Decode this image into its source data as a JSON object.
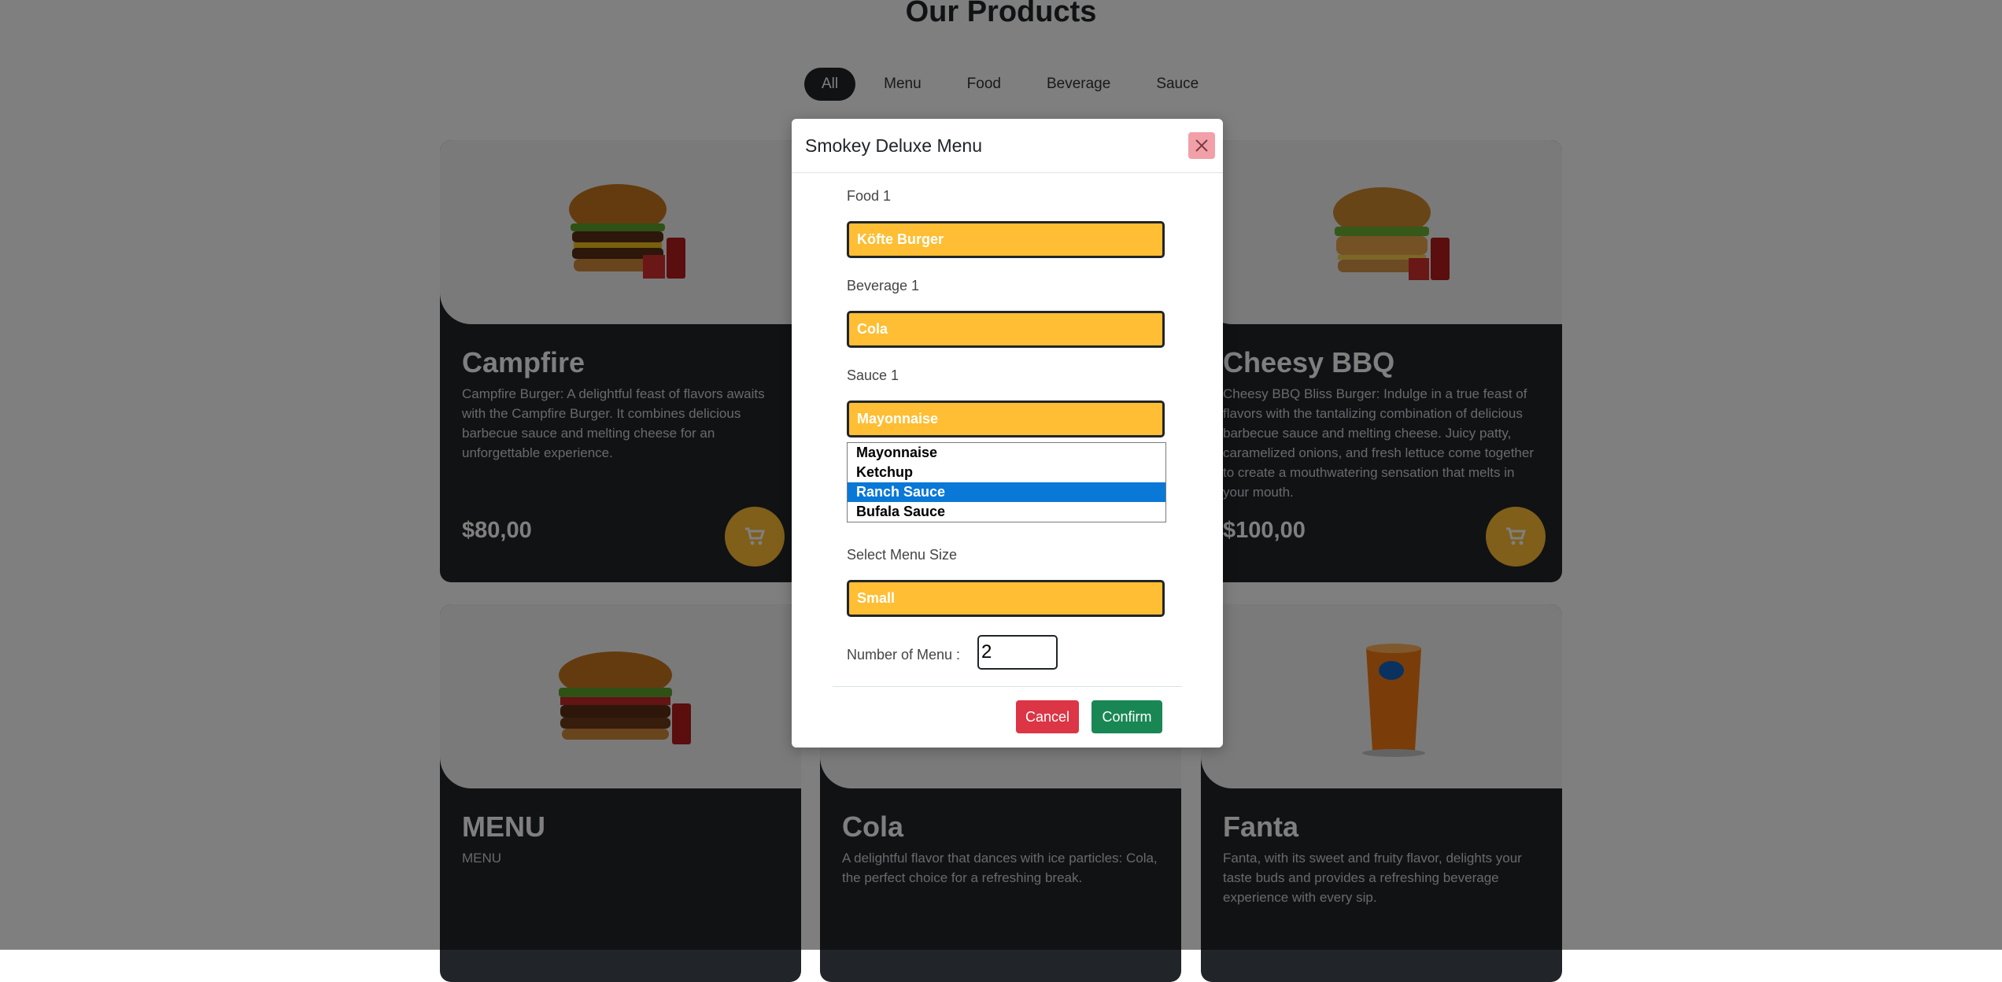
{
  "page": {
    "title": "Our Products"
  },
  "filters": [
    "All",
    "Menu",
    "Food",
    "Beverage",
    "Sauce"
  ],
  "products": [
    {
      "name": "Campfire",
      "description": "Campfire Burger: A delightful feast of flavors awaits with the Campfire Burger. It combines delicious barbecue sauce and melting cheese for an unforgettable experience.",
      "price": "$80,00"
    },
    {
      "name": "Cheesy BBQ",
      "description": "Cheesy BBQ Bliss Burger: Indulge in a true feast of flavors with the tantalizing combination of delicious barbecue sauce and melting cheese. Juicy patty, caramelized onions, and fresh lettuce come together to create a mouthwatering sensation that melts in your mouth.",
      "price": "$100,00"
    },
    {
      "name": "MENU",
      "description": "MENU"
    },
    {
      "name": "Cola",
      "description": "A delightful flavor that dances with ice particles: Cola, the perfect choice for a refreshing break."
    },
    {
      "name": "Fanta",
      "description": "Fanta, with its sweet and fruity flavor, delights your taste buds and provides a refreshing beverage experience with every sip."
    }
  ],
  "modal": {
    "title": "Smokey Deluxe Menu",
    "fields": [
      {
        "label": "Food 1",
        "value": "Köfte Burger"
      },
      {
        "label": "Beverage 1",
        "value": "Cola"
      },
      {
        "label": "Sauce 1",
        "value": "Mayonnaise"
      }
    ],
    "sauce_options": [
      "Mayonnaise",
      "Ketchup",
      "Ranch Sauce",
      "Bufala Sauce"
    ],
    "highlighted_option": "Ranch Sauce",
    "size": {
      "label": "Select Menu Size",
      "value": "Small"
    },
    "quantity": {
      "label": "Number of Menu :",
      "value": "2"
    },
    "cancel_label": "Cancel",
    "confirm_label": "Confirm"
  },
  "colors": {
    "accent": "#ffbe33",
    "dark": "#212529",
    "cancel": "#dc3545",
    "confirm": "#198754",
    "highlight": "#0a78d7"
  }
}
